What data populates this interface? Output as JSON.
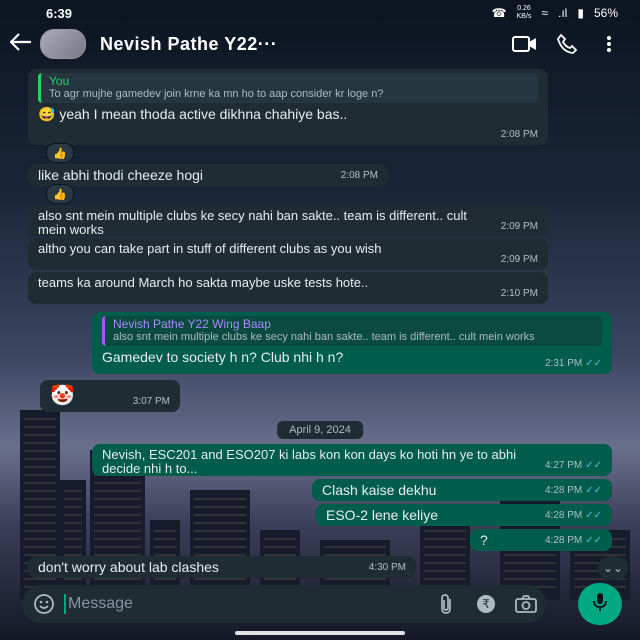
{
  "status": {
    "time": "6:39",
    "net_speed_value": "0.26",
    "net_speed_unit": "KB/s",
    "battery": "56%"
  },
  "header": {
    "title": "Nevish Pathe Y22···"
  },
  "messages": [
    {
      "quote_author": "You",
      "quote_text": "To agr mujhe gamedev join krne ka mn ho to aap consider kr loge n?",
      "text": "😅 yeah I mean thoda active dikhna chahiye bas..",
      "time": "2:08 PM",
      "reaction": "👍"
    },
    {
      "text": "like abhi thodi cheeze hogi",
      "time": "2:08 PM",
      "reaction": "👍"
    },
    {
      "text": "also snt mein multiple clubs ke secy nahi ban sakte.. team is different.. cult mein works",
      "time": "2:09 PM"
    },
    {
      "text": "altho you can take part in stuff of different clubs as you wish",
      "time": "2:09 PM"
    },
    {
      "text": "teams ka around March ho sakta maybe uske tests hote..",
      "time": "2:10 PM"
    },
    {
      "quote_author": "Nevish Pathe Y22 Wing Baap",
      "quote_text": "also snt mein multiple clubs ke secy nahi ban sakte.. team is different.. cult mein works",
      "text": "Gamedev to society h n? Club nhi h n?",
      "time": "2:31 PM"
    },
    {
      "sticker": "🤡",
      "time": "3:07 PM"
    },
    {
      "text": "Nevish, ESC201 and ESO207 ki labs  kon kon days ko hoti hn ye to abhi decide nhi h to...",
      "time": "4:27 PM"
    },
    {
      "text": "Clash kaise dekhu",
      "time": "4:28 PM"
    },
    {
      "text": "ESO-2 lene keliye",
      "time": "4:28 PM"
    },
    {
      "text": "?",
      "time": "4:28 PM"
    },
    {
      "text": "don't worry about lab clashes",
      "time": "4:30 PM"
    }
  ],
  "date_separator": "April 9, 2024",
  "composer": {
    "placeholder": "Message"
  },
  "colors": {
    "incoming": "#1f2c34",
    "outgoing": "#005c4b",
    "accent": "#00a884",
    "read_ticks": "#53bdeb"
  },
  "icons": {
    "back": "back-arrow-icon",
    "video": "video-call-icon",
    "call": "phone-icon",
    "menu": "more-vert-icon",
    "emoji": "emoji-icon",
    "attach": "paperclip-icon",
    "payment": "rupee-icon",
    "camera": "camera-icon",
    "mic": "mic-icon"
  }
}
